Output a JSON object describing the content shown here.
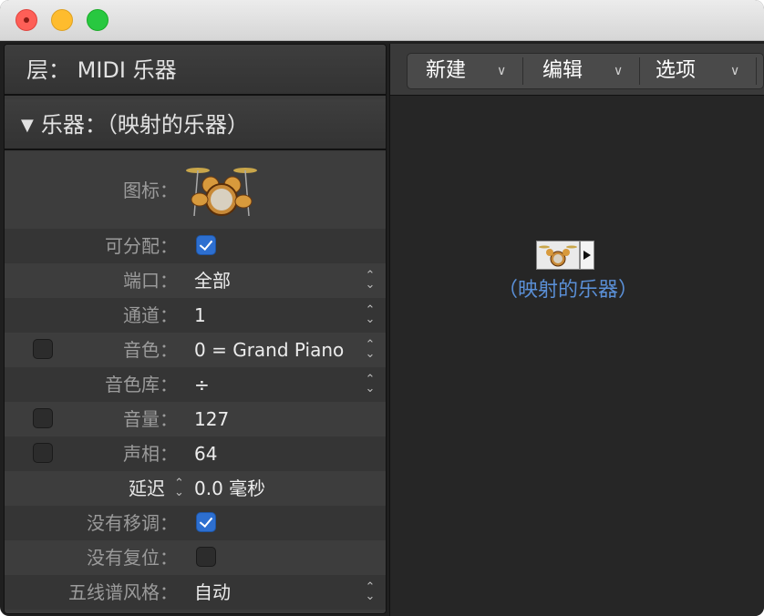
{
  "window": {
    "buttons": [
      "close",
      "minimize",
      "zoom"
    ]
  },
  "inspector": {
    "layer_header": "层：  MIDI 乐器",
    "instrument_header": "乐器：（映射的乐器）",
    "icon_label": "图标：",
    "assignable_label": "可分配：",
    "port_label": "端口：",
    "port_value": "全部",
    "channel_label": "通道：",
    "channel_value": "1",
    "program_label": "音色：",
    "program_value": "0 = Grand Piano",
    "bank_label": "音色库：",
    "bank_value": "÷",
    "volume_label": "音量：",
    "volume_value": "127",
    "pan_label": "声相：",
    "pan_value": "64",
    "delay_label": "延迟",
    "delay_value": "0.0 毫秒",
    "no_transpose_label": "没有移调：",
    "no_reset_label": "没有复位：",
    "staff_style_label": "五线谱风格：",
    "staff_style_value": "自动"
  },
  "toolbar": {
    "new_label": "新建",
    "edit_label": "编辑",
    "options_label": "选项"
  },
  "canvas": {
    "node_label": "（映射的乐器）"
  }
}
